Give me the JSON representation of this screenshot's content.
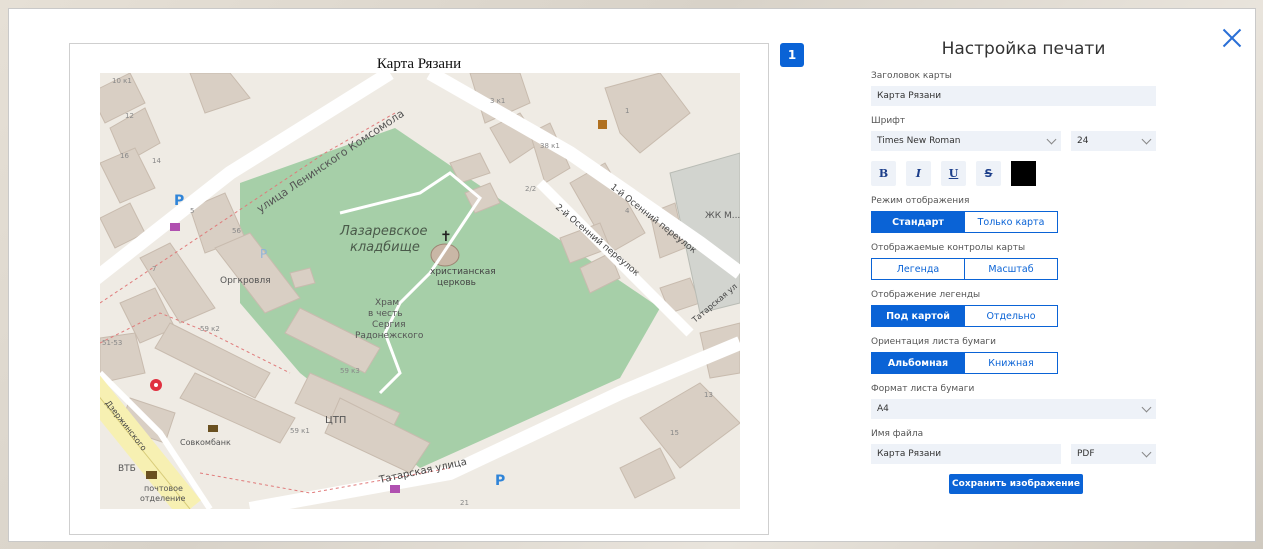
{
  "preview": {
    "page_number": "1",
    "map_title": "Карта Рязани",
    "map_labels": {
      "cemetery": "Лазаревское кладбище",
      "church": "христианская церковь",
      "temple": "Храм в честь Сергия Радонежского",
      "street_komsomol": "улица Ленинского Комсомола",
      "street_tatar": "Татарская улица",
      "lane1": "1-й Осенний переулок",
      "lane2": "2-й Осенний переулок",
      "orgkrovlya": "Оргкровля",
      "ctp": "ЦТП",
      "sovkombank": "Совкомбанк",
      "vtb": "ВТБ",
      "post": "почтовое отделение",
      "zhk": "ЖК М...",
      "tatarskaya_short": "Татарская ул",
      "dzerzhinsky": "Дзержинского",
      "house_59k2": "59 к2",
      "house_59k3": "59 к3",
      "house_59k1": "59 к1",
      "house_38k1": "38 к1",
      "house_3k1": "3 к1",
      "house_10k1": "10 к1",
      "house_12": "12",
      "house_16": "16",
      "house_14": "14",
      "house_5": "5",
      "house_56": "56",
      "house_7": "7",
      "house_21": "21",
      "house_13": "13",
      "house_15": "15",
      "house_212": "2/2",
      "house_4": "4",
      "house_1": "1",
      "house_51_53": "51-53"
    }
  },
  "panel": {
    "title": "Настройка печати",
    "map_title_label": "Заголовок карты",
    "map_title_value": "Карта Рязани",
    "font_label": "Шрифт",
    "font_value": "Times New Roman",
    "font_size": "24",
    "format_buttons": {
      "bold": "B",
      "italic": "I",
      "underline": "U",
      "strike": "S"
    },
    "text_color": "#000000",
    "display_mode_label": "Режим отображения",
    "display_mode_options": [
      "Стандарт",
      "Только карта"
    ],
    "controls_label": "Отображаемые контролы карты",
    "controls_options": [
      "Легенда",
      "Масштаб"
    ],
    "legend_label": "Отображение легенды",
    "legend_options": [
      "Под картой",
      "Отдельно"
    ],
    "orientation_label": "Ориентация листа бумаги",
    "orientation_options": [
      "Альбомная",
      "Книжная"
    ],
    "paper_format_label": "Формат листа бумаги",
    "paper_format_value": "A4",
    "filename_label": "Имя файла",
    "filename_value": "Карта Рязани",
    "file_type": "PDF",
    "save_label": "Сохранить изображение"
  },
  "colors": {
    "accent": "#0a63d6",
    "cemetery": "#9ccaa0",
    "field": "#eef2f8"
  }
}
